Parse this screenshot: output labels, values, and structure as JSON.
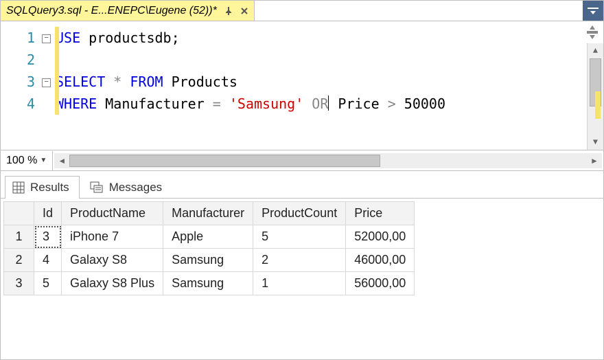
{
  "tab": {
    "title": "SQLQuery3.sql - E...ENEPC\\Eugene (52))*"
  },
  "editor": {
    "lines": [
      "1",
      "2",
      "3",
      "4"
    ],
    "code": {
      "l1_kw": "USE",
      "l1_ident": " productsdb;",
      "l3_kw1": "SELECT",
      "l3_op": " * ",
      "l3_kw2": "FROM",
      "l3_ident": " Products",
      "l4_kw1": "WHERE",
      "l4_ident1": " Manufacturer ",
      "l4_op1": "=",
      "l4_str": " 'Samsung' ",
      "l4_kw2": "OR",
      "l4_ident2": " Price ",
      "l4_op2": ">",
      "l4_num": " 50000"
    }
  },
  "zoom": {
    "value": "100 %"
  },
  "result_tabs": {
    "results": "Results",
    "messages": "Messages"
  },
  "grid": {
    "headers": {
      "id": "Id",
      "name": "ProductName",
      "manu": "Manufacturer",
      "count": "ProductCount",
      "price": "Price"
    },
    "rows": [
      {
        "n": "1",
        "id": "3",
        "name": "iPhone 7",
        "manu": "Apple",
        "count": "5",
        "price": "52000,00"
      },
      {
        "n": "2",
        "id": "4",
        "name": "Galaxy S8",
        "manu": "Samsung",
        "count": "2",
        "price": "46000,00"
      },
      {
        "n": "3",
        "id": "5",
        "name": "Galaxy S8 Plus",
        "manu": "Samsung",
        "count": "1",
        "price": "56000,00"
      }
    ]
  }
}
